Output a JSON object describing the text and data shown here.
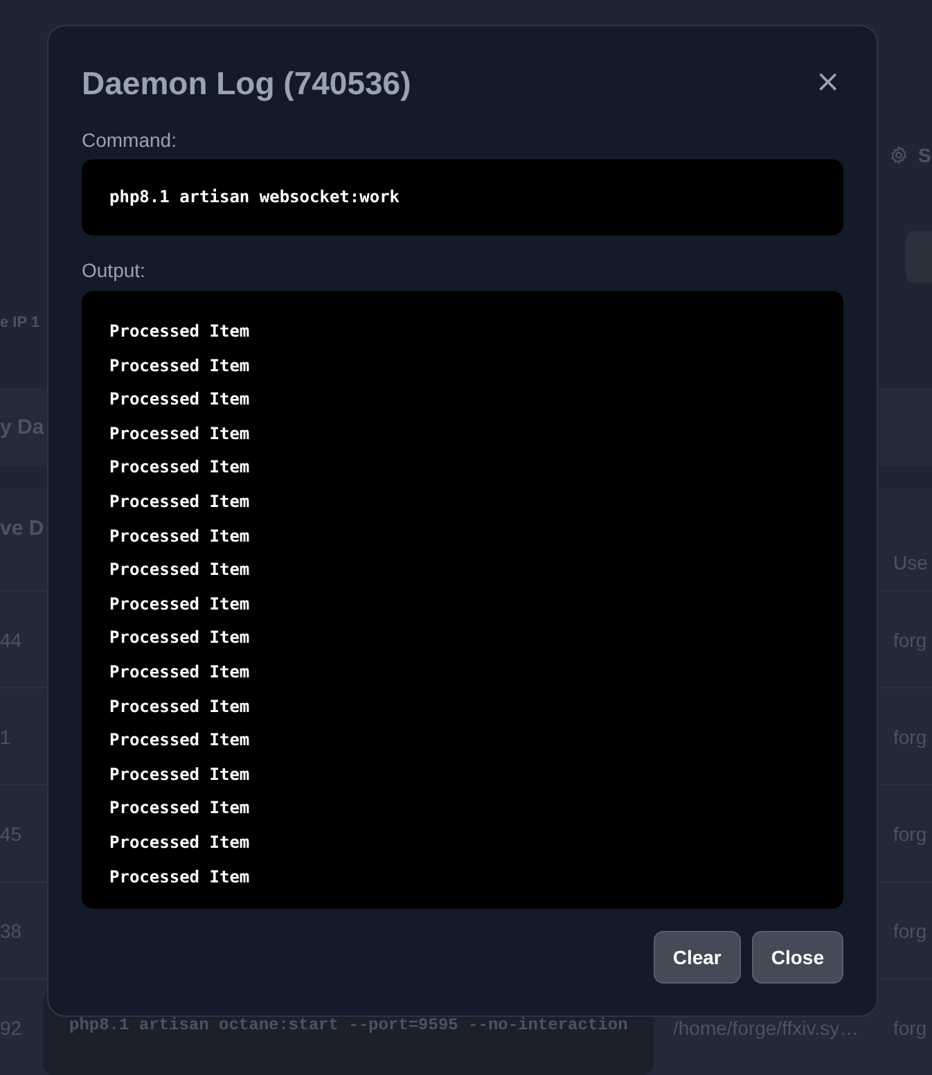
{
  "background": {
    "header_fragment": "S",
    "ip_fragment": "e IP 1",
    "section_fragments": [
      "y Da",
      "ve D"
    ],
    "table": {
      "columns": [
        {
          "label": "Use"
        }
      ],
      "rows": [
        {
          "id_fragment": "44",
          "user": "forg"
        },
        {
          "id_fragment": "1",
          "user": "forg"
        },
        {
          "id_fragment": "45",
          "user": "forg"
        },
        {
          "id_fragment": "38",
          "user": "forg"
        },
        {
          "id_fragment": "92",
          "command": "php8.1 artisan octane:start --port=9595 --no-interaction",
          "directory": "/home/forge/ffxiv.sy…",
          "user": "forg"
        }
      ]
    }
  },
  "modal": {
    "title": "Daemon Log (740536)",
    "close_label": "×",
    "command_label": "Command:",
    "command": "php8.1 artisan websocket:work",
    "output_label": "Output:",
    "output_lines": [
      "Processed Item",
      "Processed Item",
      "Processed Item",
      "Processed Item",
      "Processed Item",
      "Processed Item",
      "Processed Item",
      "Processed Item",
      "Processed Item",
      "Processed Item",
      "Processed Item",
      "Processed Item",
      "Processed Item",
      "Processed Item",
      "Processed Item",
      "Processed Item",
      "Processed Item"
    ],
    "buttons": [
      {
        "label": "Clear"
      },
      {
        "label": "Close"
      }
    ]
  }
}
